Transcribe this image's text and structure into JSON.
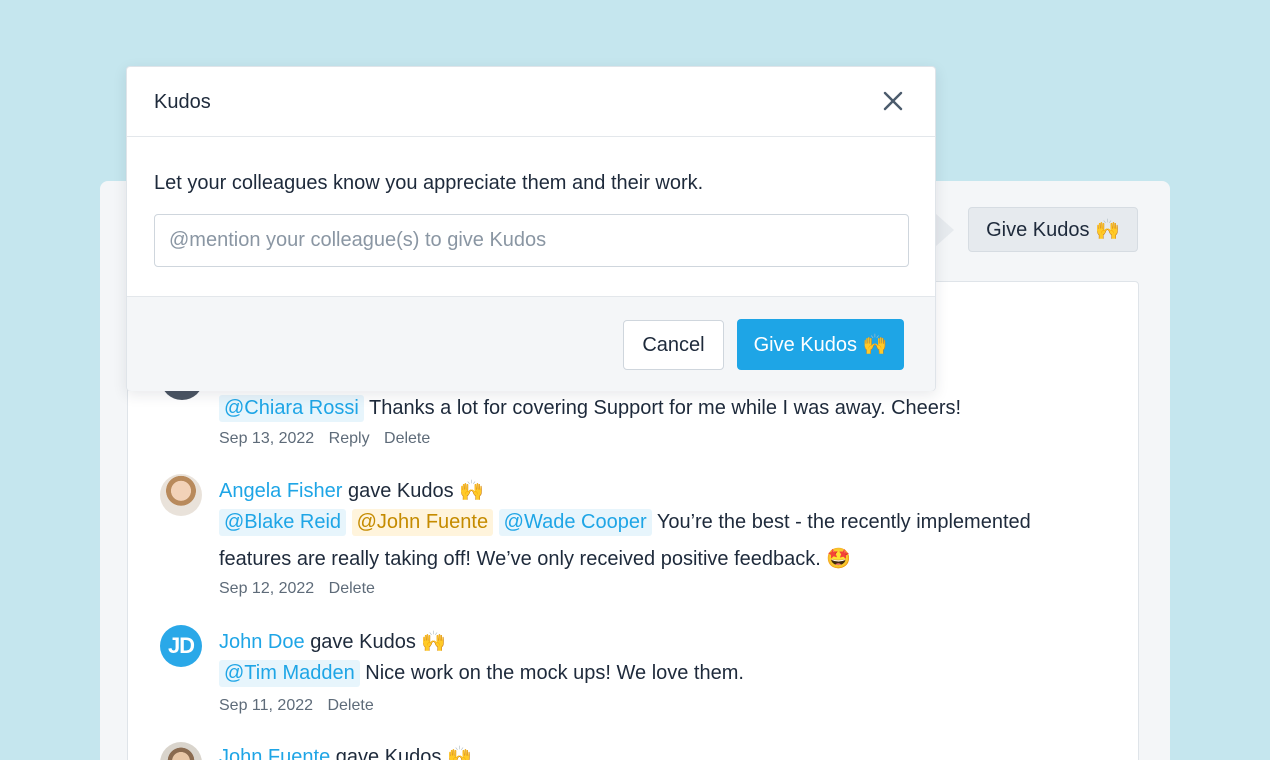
{
  "page": {
    "give_kudos_button": "Give Kudos 🙌"
  },
  "modal": {
    "title": "Kudos",
    "description": "Let your colleagues know you appreciate them and their work.",
    "input_placeholder": "@mention your colleague(s) to give Kudos",
    "input_value": "",
    "cancel_label": "Cancel",
    "submit_label": "Give Kudos 🙌"
  },
  "feed": {
    "entries": [
      {
        "mentions": [
          "@Chiara Rossi"
        ],
        "message": "Thanks a lot for covering Support for me while I was away. Cheers!",
        "date": "Sep 13, 2022",
        "actions": [
          "Reply",
          "Delete"
        ]
      },
      {
        "author": "Angela Fisher",
        "action_text": "gave Kudos",
        "emoji": "🙌",
        "mentions": [
          "@Blake Reid",
          "@John Fuente",
          "@Wade Cooper"
        ],
        "message_line1": "You’re the best - the recently implemented",
        "message_line2": "features are really taking off! We’ve only received positive feedback.",
        "message_emoji": "🤩",
        "date": "Sep 12, 2022",
        "actions": [
          "Delete"
        ]
      },
      {
        "author": "John Doe",
        "avatar_initials": "JD",
        "action_text": "gave Kudos",
        "emoji": "🙌",
        "mentions": [
          "@Tim Madden"
        ],
        "message": "Nice work on the mock ups! We love them.",
        "date": "Sep 11, 2022",
        "actions": [
          "Delete"
        ]
      },
      {
        "author": "John Fuente",
        "action_text": "gave Kudos",
        "emoji": "🙌"
      }
    ]
  },
  "colors": {
    "background": "#c5e6ee",
    "accent": "#1ea5e6",
    "mention_highlight": "#e7f5fc",
    "mention_gold": "#c58b00"
  }
}
